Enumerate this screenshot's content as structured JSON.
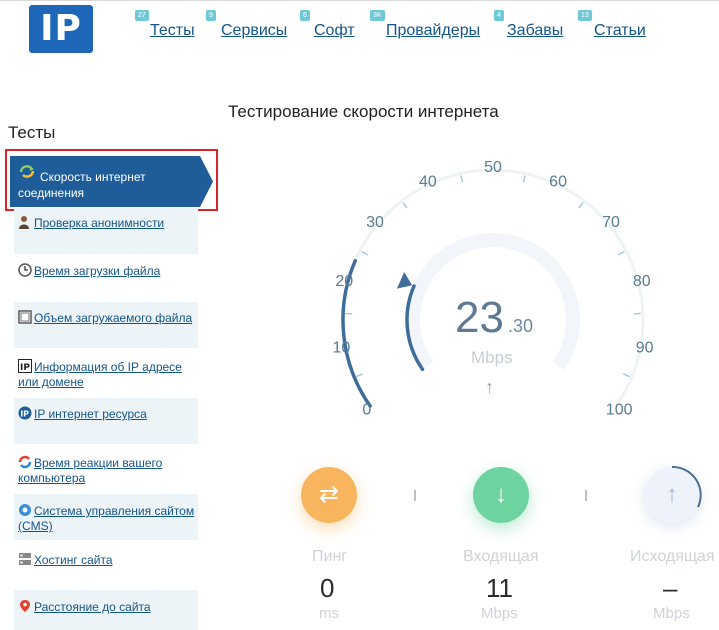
{
  "logo": {
    "text": "IP"
  },
  "nav": [
    {
      "label": "Тесты",
      "badge": "27"
    },
    {
      "label": "Сервисы",
      "badge": "9"
    },
    {
      "label": "Софт",
      "badge": "6"
    },
    {
      "label": "Провайдеры",
      "badge": "3K"
    },
    {
      "label": "Забавы",
      "badge": "4"
    },
    {
      "label": "Статьи",
      "badge": "13"
    }
  ],
  "page_title": "Тестирование скорости интернета",
  "sidebar": {
    "title": "Тесты",
    "active_item": {
      "label": "Скорость интернет соединения",
      "icon": "speed-arrows-icon"
    },
    "items": [
      {
        "label": "Проверка анонимности",
        "icon": "person-icon"
      },
      {
        "label": "Время загрузки файла",
        "icon": "clock-icon"
      },
      {
        "label": "Объем загружаемого файла",
        "icon": "file-size-icon"
      },
      {
        "label": "Информация об IP адресе или домене",
        "icon": "ip-icon"
      },
      {
        "label": "IP интернет ресурса",
        "icon": "ip-globe-icon"
      },
      {
        "label": "Время реакции вашего компьютера",
        "icon": "refresh-icon"
      },
      {
        "label": "Система управления сайтом (CMS)",
        "icon": "cms-icon"
      },
      {
        "label": "Хостинг сайта",
        "icon": "server-icon"
      },
      {
        "label": "Расстояние до сайта",
        "icon": "map-pin-icon"
      }
    ]
  },
  "speedometer": {
    "scale_labels": [
      "0",
      "10",
      "20",
      "30",
      "40",
      "50",
      "60",
      "70",
      "80",
      "90",
      "100"
    ],
    "speed_integer": "23",
    "speed_decimal": ".30",
    "unit": "Mbps",
    "needle_value": 23.3,
    "scale_max": 100
  },
  "stats": {
    "ping": {
      "label": "Пинг",
      "value": "0",
      "unit": "ms",
      "icon": "swap-arrows-icon"
    },
    "download": {
      "label": "Входящая",
      "value": "11",
      "unit": "Mbps",
      "icon": "down-arrow-icon"
    },
    "upload": {
      "label": "Исходящая",
      "value": "–",
      "unit": "Mbps",
      "icon": "up-arrow-icon"
    }
  },
  "colors": {
    "brand_blue": "#1e67b8",
    "active_bg": "#1e5d99",
    "highlight_red": "#d9232d",
    "ping_orange": "#f8b55d",
    "download_green": "#6dd39f",
    "gauge_blue": "#3f6d9b"
  }
}
